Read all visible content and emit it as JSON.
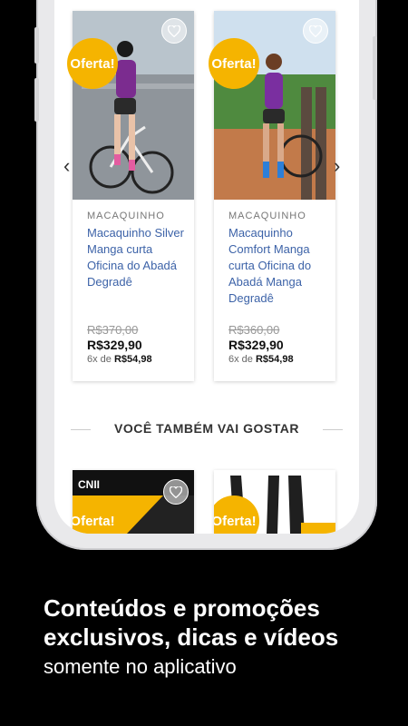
{
  "products": [
    {
      "category": "MACAQUINHO",
      "name": "Macaquinho Silver Manga curta Oficina do Abadá Degradê",
      "old_price": "R$370,00",
      "price": "R$329,90",
      "installments_prefix": "6x de",
      "installments_value": "R$54,98",
      "badge": "Oferta!"
    },
    {
      "category": "MACAQUINHO",
      "name": "Macaquinho Comfort Manga curta Oficina do Abadá Manga Degradê",
      "old_price": "R$360,00",
      "price": "R$329,90",
      "installments_prefix": "6x de",
      "installments_value": "R$54,98",
      "badge": "Oferta!"
    }
  ],
  "section_title": "VOCÊ TAMBÉM VAI GOSTAR",
  "recommended": [
    {
      "badge": "Oferta!"
    },
    {
      "badge": "Oferta!"
    }
  ],
  "carousel": {
    "prev_icon": "‹",
    "next_icon": "›"
  },
  "promo": {
    "line1": "Conteúdos e promoções",
    "line2": "exclusivos, dicas e vídeos",
    "line3": "somente no aplicativo"
  },
  "colors": {
    "badge": "#f5b400",
    "product_name": "#3d63a8",
    "background": "#000000"
  }
}
